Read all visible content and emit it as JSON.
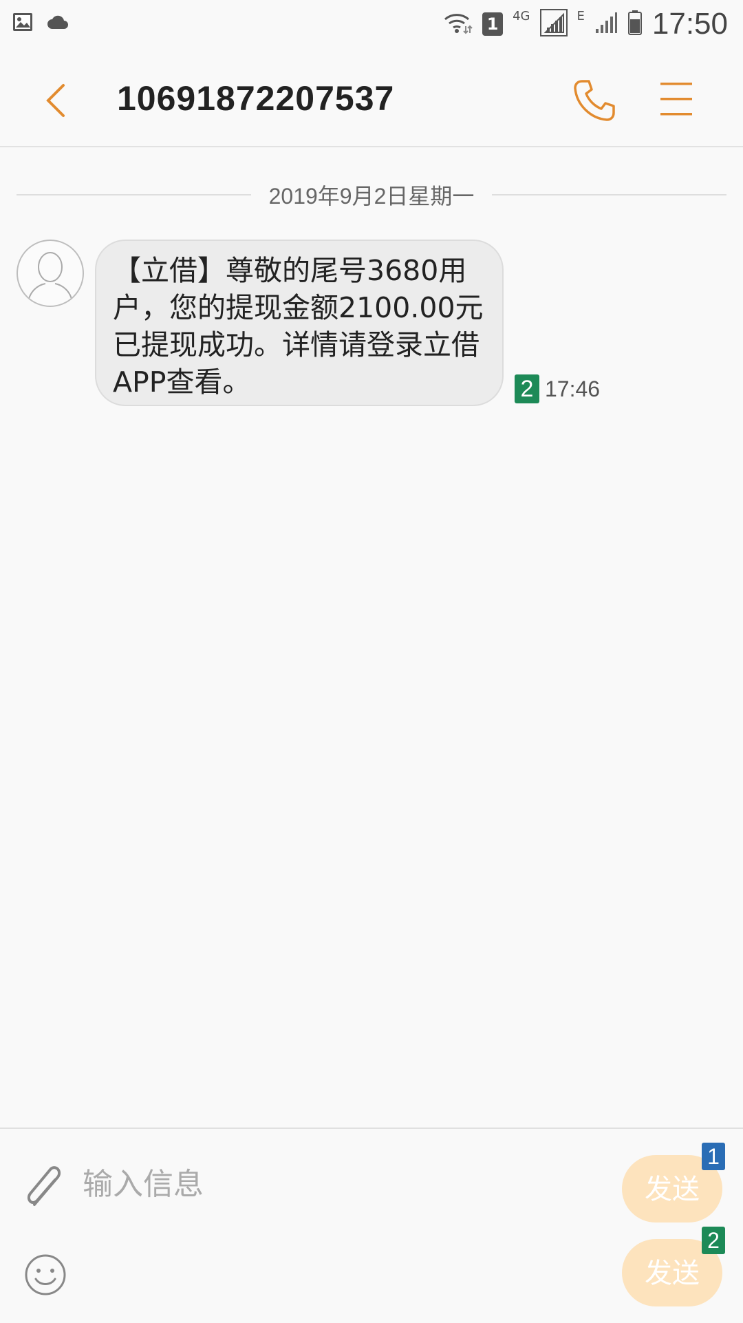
{
  "status_bar": {
    "sim_slot": "1",
    "network_1": "4G",
    "network_2": "E",
    "time": "17:50"
  },
  "app_bar": {
    "title": "10691872207537",
    "accent_color": "#e28b2f"
  },
  "conversation": {
    "date_separator": "2019年9月2日星期一",
    "messages": [
      {
        "text": "【立借】尊敬的尾号3680用户，您的提现金额2100.00元已提现成功。详情请登录立借APP查看。",
        "sim": "2",
        "time": "17:46"
      }
    ]
  },
  "composer": {
    "placeholder": "输入信息",
    "send_buttons": [
      {
        "label": "发送",
        "sim": "1",
        "sim_color": "#2a6db5"
      },
      {
        "label": "发送",
        "sim": "2",
        "sim_color": "#1d8a57"
      }
    ]
  }
}
